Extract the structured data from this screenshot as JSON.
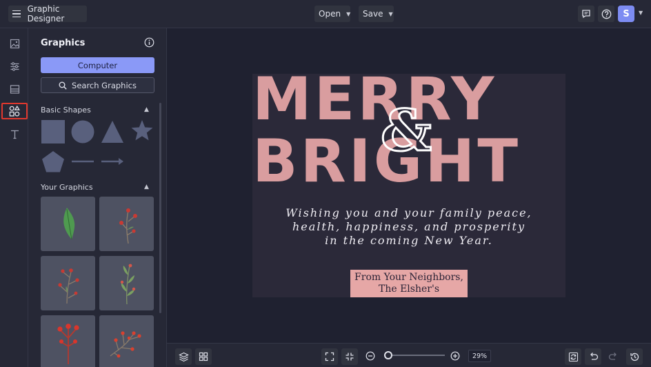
{
  "topbar": {
    "app_title": "Graphic Designer",
    "open_label": "Open",
    "save_label": "Save",
    "avatar_initial": "S"
  },
  "rail": {
    "items": [
      "image-icon",
      "sliders-icon",
      "background-icon",
      "graphics-icon",
      "text-icon"
    ],
    "active": "graphics-icon"
  },
  "panel": {
    "title": "Graphics",
    "computer_label": "Computer",
    "search_label": "Search Graphics",
    "basic_shapes_title": "Basic Shapes",
    "your_graphics_title": "Your Graphics",
    "shape_color": "#59607d",
    "shapes": [
      "square",
      "circle",
      "triangle",
      "star",
      "pentagon",
      "line",
      "arrow"
    ],
    "graphics": [
      "holly-leaf",
      "berry-sprig",
      "berry-branch",
      "green-sprig",
      "red-flower-stem",
      "berry-cluster"
    ]
  },
  "card": {
    "line1": "MERRY",
    "amp": "&",
    "line2": "BRIGHT",
    "wish_line1": "Wishing you and your family peace,",
    "wish_line2": "health, happiness, and prosperity",
    "wish_line3": "in the coming New Year.",
    "from_line1": "From Your Neighbors,",
    "from_line2": "The Elsher's",
    "accent_color": "#d99d9f",
    "background_color": "#2b2939"
  },
  "bottombar": {
    "zoom_value": "29%",
    "zoom_level": 0.04
  },
  "colors": {
    "primary": "#8a99f7",
    "active_outline": "#e0382e"
  }
}
